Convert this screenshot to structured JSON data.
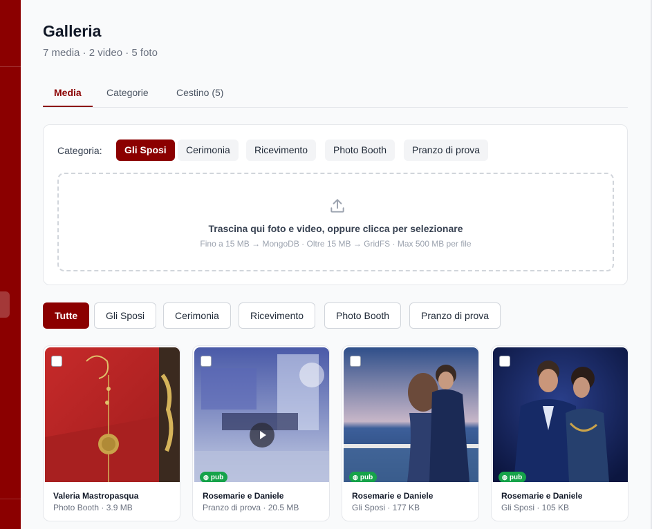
{
  "page": {
    "title": "Galleria",
    "subtitle": "7 media · 2 video · 5 foto"
  },
  "tabs": [
    {
      "label": "Media",
      "active": true
    },
    {
      "label": "Categorie",
      "active": false
    },
    {
      "label": "Cestino (5)",
      "active": false
    }
  ],
  "upload": {
    "category_label": "Categoria:",
    "categories": [
      "Gli Sposi",
      "Cerimonia",
      "Ricevimento",
      "Photo Booth",
      "Pranzo di prova"
    ],
    "selected_category": "Gli Sposi",
    "icon": "upload-icon",
    "drop_text": "Trascina qui foto e video, oppure clicca per selezionare",
    "drop_hint": "Fino a 15 MB → MongoDB · Oltre 15 MB → GridFS · Max 500 MB per file"
  },
  "filters": [
    "Tutte",
    "Gli Sposi",
    "Cerimonia",
    "Ricevimento",
    "Photo Booth",
    "Pranzo di prova"
  ],
  "active_filter": "Tutte",
  "media": [
    {
      "name": "Valeria Mastropasqua",
      "meta": "Photo Booth · 3.9 MB",
      "badge": "",
      "is_video": false
    },
    {
      "name": "Rosemarie e Daniele",
      "meta": "Pranzo di prova · 20.5 MB",
      "badge": "pub",
      "is_video": true
    },
    {
      "name": "Rosemarie e Daniele",
      "meta": "Gli Sposi · 177 KB",
      "badge": "pub",
      "is_video": false
    },
    {
      "name": "Rosemarie e Daniele",
      "meta": "Gli Sposi · 105 KB",
      "badge": "pub",
      "is_video": false
    }
  ],
  "colors": {
    "brand": "#8b0000",
    "badge_green": "#16a34a"
  }
}
